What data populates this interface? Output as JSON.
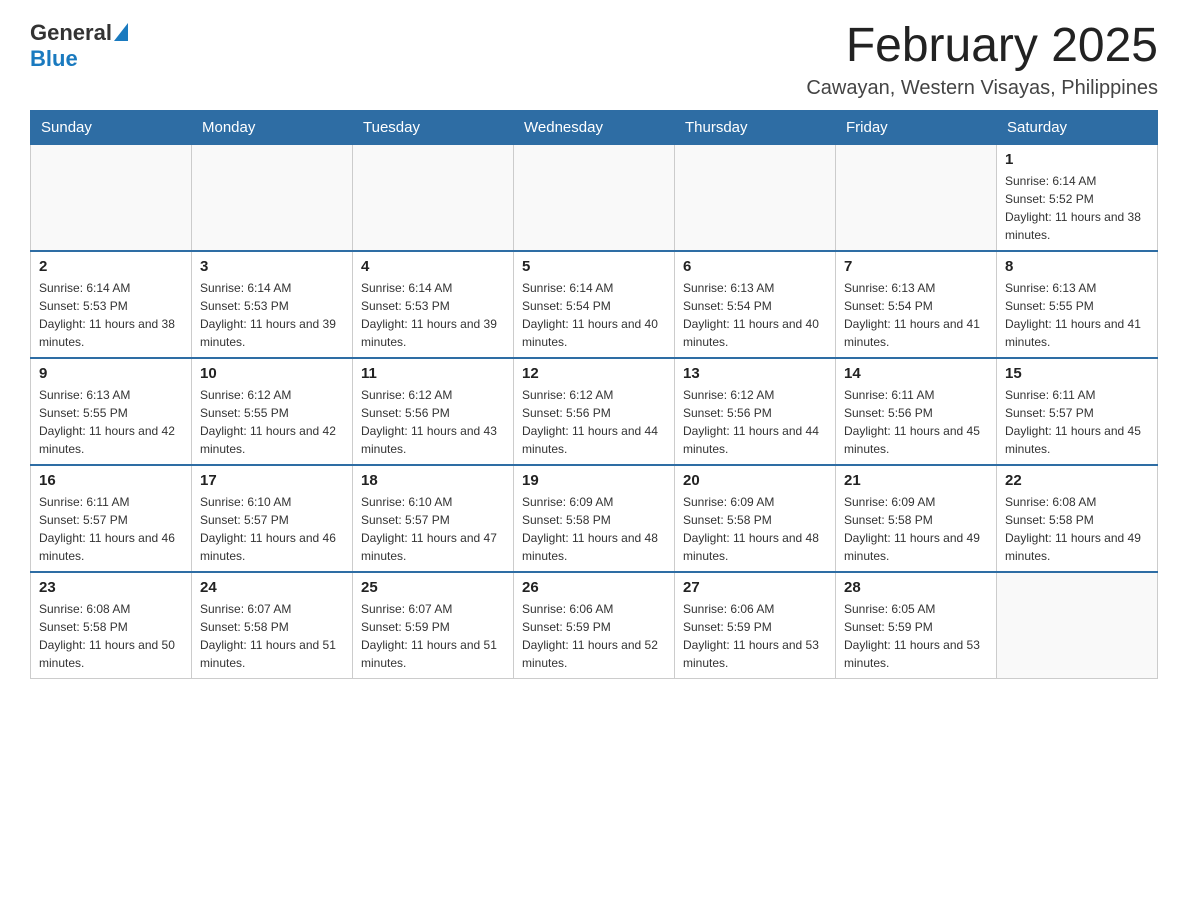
{
  "header": {
    "logo_general": "General",
    "logo_blue": "Blue",
    "title": "February 2025",
    "subtitle": "Cawayan, Western Visayas, Philippines"
  },
  "days_of_week": [
    "Sunday",
    "Monday",
    "Tuesday",
    "Wednesday",
    "Thursday",
    "Friday",
    "Saturday"
  ],
  "weeks": [
    [
      {
        "day": "",
        "info": ""
      },
      {
        "day": "",
        "info": ""
      },
      {
        "day": "",
        "info": ""
      },
      {
        "day": "",
        "info": ""
      },
      {
        "day": "",
        "info": ""
      },
      {
        "day": "",
        "info": ""
      },
      {
        "day": "1",
        "info": "Sunrise: 6:14 AM\nSunset: 5:52 PM\nDaylight: 11 hours and 38 minutes."
      }
    ],
    [
      {
        "day": "2",
        "info": "Sunrise: 6:14 AM\nSunset: 5:53 PM\nDaylight: 11 hours and 38 minutes."
      },
      {
        "day": "3",
        "info": "Sunrise: 6:14 AM\nSunset: 5:53 PM\nDaylight: 11 hours and 39 minutes."
      },
      {
        "day": "4",
        "info": "Sunrise: 6:14 AM\nSunset: 5:53 PM\nDaylight: 11 hours and 39 minutes."
      },
      {
        "day": "5",
        "info": "Sunrise: 6:14 AM\nSunset: 5:54 PM\nDaylight: 11 hours and 40 minutes."
      },
      {
        "day": "6",
        "info": "Sunrise: 6:13 AM\nSunset: 5:54 PM\nDaylight: 11 hours and 40 minutes."
      },
      {
        "day": "7",
        "info": "Sunrise: 6:13 AM\nSunset: 5:54 PM\nDaylight: 11 hours and 41 minutes."
      },
      {
        "day": "8",
        "info": "Sunrise: 6:13 AM\nSunset: 5:55 PM\nDaylight: 11 hours and 41 minutes."
      }
    ],
    [
      {
        "day": "9",
        "info": "Sunrise: 6:13 AM\nSunset: 5:55 PM\nDaylight: 11 hours and 42 minutes."
      },
      {
        "day": "10",
        "info": "Sunrise: 6:12 AM\nSunset: 5:55 PM\nDaylight: 11 hours and 42 minutes."
      },
      {
        "day": "11",
        "info": "Sunrise: 6:12 AM\nSunset: 5:56 PM\nDaylight: 11 hours and 43 minutes."
      },
      {
        "day": "12",
        "info": "Sunrise: 6:12 AM\nSunset: 5:56 PM\nDaylight: 11 hours and 44 minutes."
      },
      {
        "day": "13",
        "info": "Sunrise: 6:12 AM\nSunset: 5:56 PM\nDaylight: 11 hours and 44 minutes."
      },
      {
        "day": "14",
        "info": "Sunrise: 6:11 AM\nSunset: 5:56 PM\nDaylight: 11 hours and 45 minutes."
      },
      {
        "day": "15",
        "info": "Sunrise: 6:11 AM\nSunset: 5:57 PM\nDaylight: 11 hours and 45 minutes."
      }
    ],
    [
      {
        "day": "16",
        "info": "Sunrise: 6:11 AM\nSunset: 5:57 PM\nDaylight: 11 hours and 46 minutes."
      },
      {
        "day": "17",
        "info": "Sunrise: 6:10 AM\nSunset: 5:57 PM\nDaylight: 11 hours and 46 minutes."
      },
      {
        "day": "18",
        "info": "Sunrise: 6:10 AM\nSunset: 5:57 PM\nDaylight: 11 hours and 47 minutes."
      },
      {
        "day": "19",
        "info": "Sunrise: 6:09 AM\nSunset: 5:58 PM\nDaylight: 11 hours and 48 minutes."
      },
      {
        "day": "20",
        "info": "Sunrise: 6:09 AM\nSunset: 5:58 PM\nDaylight: 11 hours and 48 minutes."
      },
      {
        "day": "21",
        "info": "Sunrise: 6:09 AM\nSunset: 5:58 PM\nDaylight: 11 hours and 49 minutes."
      },
      {
        "day": "22",
        "info": "Sunrise: 6:08 AM\nSunset: 5:58 PM\nDaylight: 11 hours and 49 minutes."
      }
    ],
    [
      {
        "day": "23",
        "info": "Sunrise: 6:08 AM\nSunset: 5:58 PM\nDaylight: 11 hours and 50 minutes."
      },
      {
        "day": "24",
        "info": "Sunrise: 6:07 AM\nSunset: 5:58 PM\nDaylight: 11 hours and 51 minutes."
      },
      {
        "day": "25",
        "info": "Sunrise: 6:07 AM\nSunset: 5:59 PM\nDaylight: 11 hours and 51 minutes."
      },
      {
        "day": "26",
        "info": "Sunrise: 6:06 AM\nSunset: 5:59 PM\nDaylight: 11 hours and 52 minutes."
      },
      {
        "day": "27",
        "info": "Sunrise: 6:06 AM\nSunset: 5:59 PM\nDaylight: 11 hours and 53 minutes."
      },
      {
        "day": "28",
        "info": "Sunrise: 6:05 AM\nSunset: 5:59 PM\nDaylight: 11 hours and 53 minutes."
      },
      {
        "day": "",
        "info": ""
      }
    ]
  ]
}
